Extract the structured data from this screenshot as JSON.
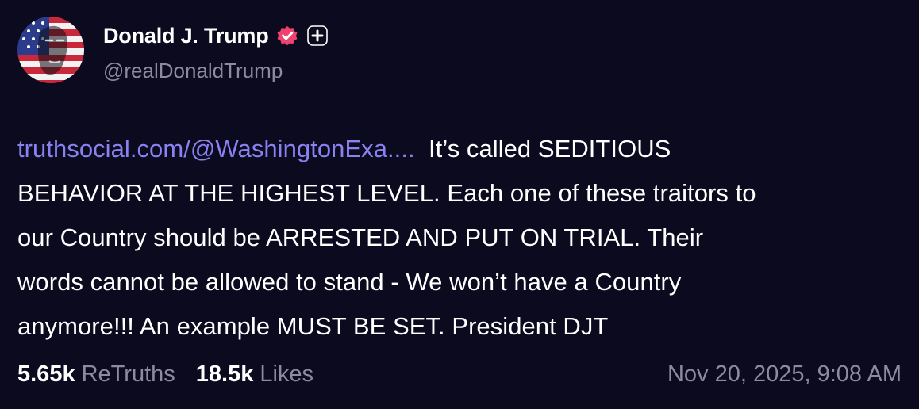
{
  "author": {
    "name": "Donald J. Trump",
    "handle": "@realDonaldTrump",
    "verified_icon": "verified-check-icon",
    "badge_icon": "plus-badge-icon",
    "verified_color": "#f0426e"
  },
  "post": {
    "link_text": "truthsocial.com/@WashingtonExa....",
    "lines": [
      "  It’s called SEDITIOUS",
      "BEHAVIOR AT THE HIGHEST LEVEL. Each one of these traitors to",
      "our Country should be ARRESTED AND PUT ON TRIAL. Their",
      "words cannot be allowed to stand - We won’t have a Country",
      "anymore!!! An example MUST BE SET. President DJT"
    ]
  },
  "stats": {
    "retruths_count": "5.65k",
    "retruths_label": "ReTruths",
    "likes_count": "18.5k",
    "likes_label": "Likes"
  },
  "timestamp": "Nov 20, 2025, 9:08 AM",
  "colors": {
    "background": "#0b0a1e",
    "link": "#8b82f2",
    "muted": "#8d8b9c"
  }
}
